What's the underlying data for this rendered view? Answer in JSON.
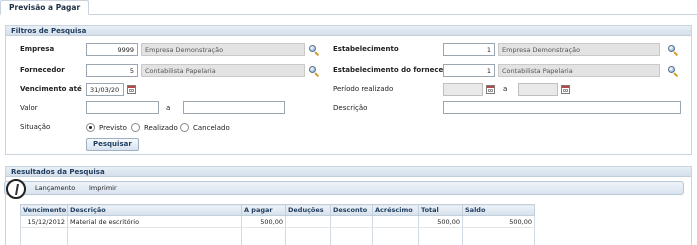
{
  "tab": {
    "label": "Previsão a Pagar"
  },
  "filters": {
    "header": "Filtros de Pesquisa",
    "empresa": {
      "label": "Empresa",
      "code": "9999",
      "name": "Empresa Demonstração"
    },
    "fornecedor": {
      "label": "Fornecedor",
      "code": "5",
      "name": "Contabilista Papelaria"
    },
    "vencimento_ate": {
      "label": "Vencimento até",
      "value": "31/03/2013"
    },
    "valor": {
      "label": "Valor",
      "from": "",
      "separator": "a",
      "to": ""
    },
    "situacao": {
      "label": "Situação",
      "options": [
        {
          "label": "Previsto",
          "selected": true
        },
        {
          "label": "Realizado",
          "selected": false
        },
        {
          "label": "Cancelado",
          "selected": false
        }
      ]
    },
    "estabelecimento": {
      "label": "Estabelecimento",
      "code": "1",
      "name": "Empresa Demonstração"
    },
    "estabelecimento_fornecedor": {
      "label": "Estabelecimento do fornecedor",
      "code": "1",
      "name": "Contabilista Papelaria"
    },
    "periodo_realizado": {
      "label": "Período realizado",
      "from": "",
      "separator": "a",
      "to": ""
    },
    "descricao": {
      "label": "Descrição",
      "value": ""
    },
    "search_button": "Pesquisar"
  },
  "results": {
    "header": "Resultados da Pesquisa",
    "toolbar": [
      "Lançamento",
      "Imprimir"
    ],
    "columns": [
      "Vencimento",
      "Descrição",
      "A pagar",
      "Deduções",
      "Desconto",
      "Acréscimo",
      "Total",
      "Saldo"
    ],
    "rows": [
      [
        "15/12/2012",
        "Material de escritório",
        "500,00",
        "",
        "",
        "",
        "500,00",
        "500,00"
      ]
    ]
  },
  "icons": {
    "search": "magnifier-icon",
    "calendar": "calendar-icon"
  },
  "colors": {
    "header_text": "#1f3c5e",
    "panel_header_bg": "#d4dfeb",
    "border": "#c8d4e0"
  }
}
